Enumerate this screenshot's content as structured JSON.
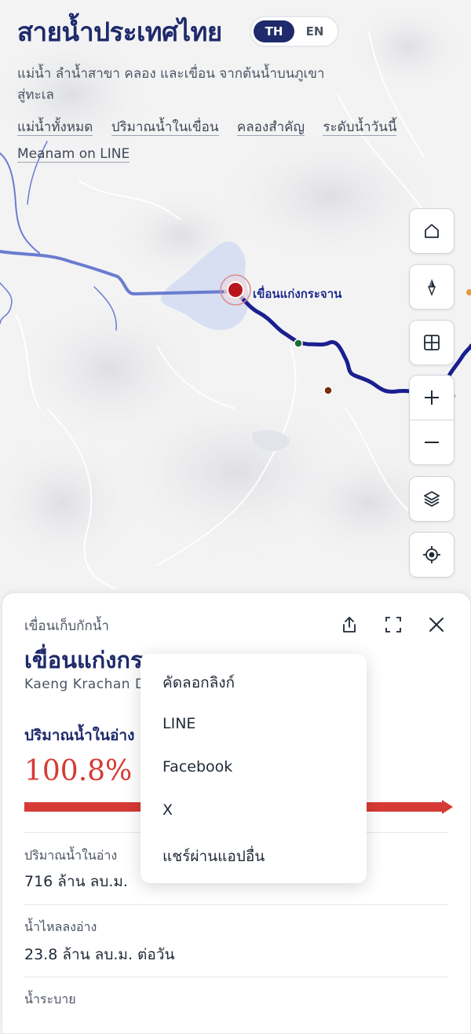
{
  "header": {
    "title": "สายน้ำประเทศไทย",
    "lang": {
      "th": "TH",
      "en": "EN"
    },
    "subtitle": "แม่น้ำ ลำน้ำสาขา คลอง และเขื่อน จากต้นน้ำบนภูเขาสู่ทะเล",
    "links": [
      "แม่น้ำทั้งหมด",
      "ปริมาณน้ำในเขื่อน",
      "คลองสำคัญ",
      "ระดับน้ำวันนี้",
      "Meanam on LINE"
    ]
  },
  "map": {
    "dam_label": "เขื่อนแก่งกระจาน",
    "controls": [
      "home-icon",
      "compass-icon",
      "grid-icon",
      "zoom-in-icon",
      "zoom-out-icon",
      "layers-icon",
      "locate-icon"
    ]
  },
  "panel": {
    "type": "เขื่อนเก็บกักน้ำ",
    "name": "เขื่อนแก่งกระจาน",
    "name_en": "Kaeng Krachan Dam",
    "section": "ปริมาณน้ำในอ่าง",
    "percent": "100.8%",
    "percent_value": 100.8,
    "stats": [
      {
        "label": "ปริมาณน้ำในอ่าง",
        "value": "716 ล้าน ลบ.ม."
      },
      {
        "label": "น้ำไหลลงอ่าง",
        "value": "23.8 ล้าน ลบ.ม. ต่อวัน"
      },
      {
        "label": "น้ำระบาย",
        "value": ""
      }
    ]
  },
  "share_menu": {
    "items": [
      "คัดลอกลิงก์",
      "LINE",
      "Facebook",
      "X",
      "แชร์ผ่านแอปอื่น"
    ]
  },
  "colors": {
    "navy": "#1e2a6b",
    "river": "#1a1f8f",
    "accent_red": "#d63a34"
  }
}
